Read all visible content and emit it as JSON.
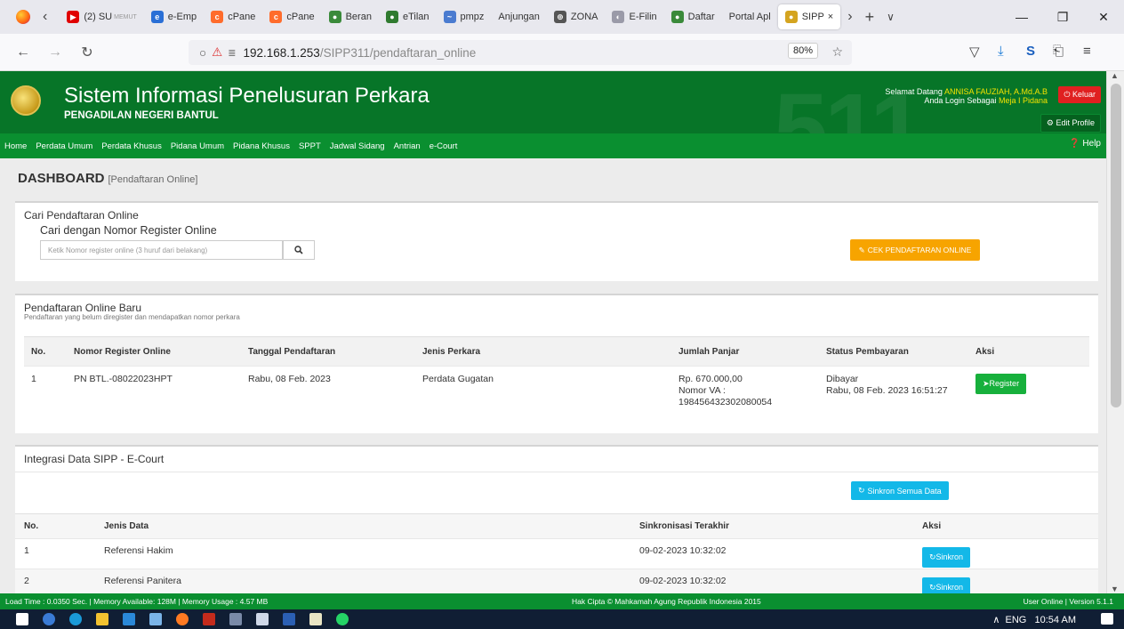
{
  "browser": {
    "tabs": [
      {
        "label": "(2) SU",
        "sub": "MEMUT",
        "color": "#e00000",
        "glyph": "▶",
        "active": false
      },
      {
        "label": "e-Emp",
        "color": "#2a6fd6",
        "glyph": "e",
        "active": false
      },
      {
        "label": "cPane",
        "color": "#ff6c2c",
        "glyph": "c",
        "active": false
      },
      {
        "label": "cPane",
        "color": "#ff6c2c",
        "glyph": "c",
        "active": false
      },
      {
        "label": "Beran",
        "color": "#3a8a3a",
        "glyph": "●",
        "active": false
      },
      {
        "label": "eTilan",
        "color": "#2f7a2f",
        "glyph": "●",
        "active": false
      },
      {
        "label": "pmpz",
        "color": "#4a7bd0",
        "glyph": "~",
        "active": false
      },
      {
        "label": "Anjungan",
        "color": "",
        "glyph": "",
        "active": false
      },
      {
        "label": "ZONA",
        "color": "#555555",
        "glyph": "⊕",
        "active": false
      },
      {
        "label": "E-Filin",
        "color": "#9a9aa8",
        "glyph": "◐",
        "active": false
      },
      {
        "label": "Daftar",
        "color": "#3a8a3a",
        "glyph": "●",
        "active": false
      },
      {
        "label": "Portal Apl",
        "color": "",
        "glyph": "",
        "active": false
      },
      {
        "label": "SIPP",
        "color": "#d4a420",
        "glyph": "●",
        "active": true
      }
    ],
    "active_tab_close": "×",
    "new_tab": "+",
    "tab_list": "∨",
    "url_host": "192.168.1.253",
    "url_path": "/SIPP311/pendaftaran_online",
    "zoom": "80%"
  },
  "header": {
    "title": "Sistem Informasi Penelusuran Perkara",
    "subtitle": "PENGADILAN NEGERI BANTUL",
    "bg_number": "511",
    "welcome_prefix": "Selamat Datang",
    "user_name": "ANNISA FAUZIAH, A.Md.A.B",
    "login_prefix": "Anda Login Sebagai",
    "role": "Meja I Pidana",
    "logout_label": "Keluar",
    "edit_profile_label": "Edit Profile"
  },
  "menu": {
    "items": [
      "Home",
      "Perdata Umum",
      "Perdata Khusus",
      "Pidana Umum",
      "Pidana Khusus",
      "SPPT",
      "Jadwal Sidang",
      "Antrian",
      "e-Court"
    ],
    "help_label": "Help"
  },
  "dashboard": {
    "title": "DASHBOARD",
    "subtitle": "[Pendaftaran Online]"
  },
  "search_panel": {
    "title": "Cari Pendaftaran Online",
    "label": "Cari dengan Nomor Register Online",
    "placeholder": "Ketik Nomor register online (3 huruf dari belakang)",
    "check_button": "CEK PENDAFTARAN ONLINE"
  },
  "new_registration": {
    "title": "Pendaftaran Online Baru",
    "description": "Pendaftaran yang belum diregister dan mendapatkan nomor perkara",
    "columns": [
      "No.",
      "Nomor Register Online",
      "Tanggal Pendaftaran",
      "Jenis Perkara",
      "Jumlah Panjar",
      "Status Pembayaran",
      "Aksi"
    ],
    "rows": [
      {
        "no": "1",
        "nomor": "PN BTL.-08022023HPT",
        "tanggal": "Rabu, 08 Feb. 2023",
        "jenis": "Perdata Gugatan",
        "panjar_amount": "Rp. 670.000,00",
        "panjar_va_label": "Nomor VA :",
        "panjar_va": "198456432302080054",
        "status": "Dibayar",
        "status_date": "Rabu, 08 Feb. 2023 16:51:27",
        "action": "Register"
      }
    ]
  },
  "integration": {
    "title": "Integrasi Data SIPP - E-Court",
    "sync_all_label": "Sinkron Semua Data",
    "columns": [
      "No.",
      "Jenis Data",
      "Sinkronisasi Terakhir",
      "Aksi"
    ],
    "rows": [
      {
        "no": "1",
        "jenis": "Referensi Hakim",
        "last_sync": "09-02-2023 10:32:02",
        "action": "Sinkron"
      },
      {
        "no": "2",
        "jenis": "Referensi Panitera",
        "last_sync": "09-02-2023 10:32:02",
        "action": "Sinkron"
      }
    ]
  },
  "footer": {
    "left": "Load Time : 0.0350 Sec.  |  Memory Available: 128M  |  Memory Usage : 4.57 MB",
    "center": "Hak Cipta © Mahkamah Agung Republik Indonesia 2015",
    "right": "User Online  |  Version 5.1.1"
  },
  "taskbar": {
    "language": "ENG",
    "time": "10:54 AM"
  },
  "colors": {
    "header_green": "#077528",
    "menu_green": "#0a8f30",
    "orange_button": "#f7a400",
    "register_green": "#17b03c",
    "sync_cyan": "#13b8e8",
    "logout_red": "#e02020"
  }
}
